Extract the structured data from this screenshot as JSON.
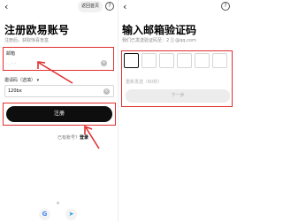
{
  "left": {
    "back_icon": "‹",
    "return_home": "返回首页",
    "help_icon": "?",
    "title": "注册欧易账号",
    "subtitle": "注册后，获取惊喜盲盒",
    "email": {
      "label": "邮箱",
      "value": "·  ,   ·  ·",
      "clear_icon": "×"
    },
    "invite": {
      "label": "邀请码（选填）",
      "caret": "▾",
      "value": "120bx",
      "clear_icon": "×"
    },
    "register_button": "注册",
    "login_prompt": "已有账号？",
    "login_link": "登录",
    "social": {
      "google": "G",
      "telegram": "➤"
    }
  },
  "right": {
    "back_icon": "‹",
    "help_icon": "?",
    "title": "输入邮箱验证码",
    "subtitle": "我们已发送验证码至：2",
    "subtitle_email": "@qq.com",
    "resend": "重新发送（60秒）",
    "next_button": "下一步"
  },
  "colors": {
    "highlight": "#e23030",
    "primary_button": "#0e0e0e",
    "disabled_button": "#ececec"
  }
}
